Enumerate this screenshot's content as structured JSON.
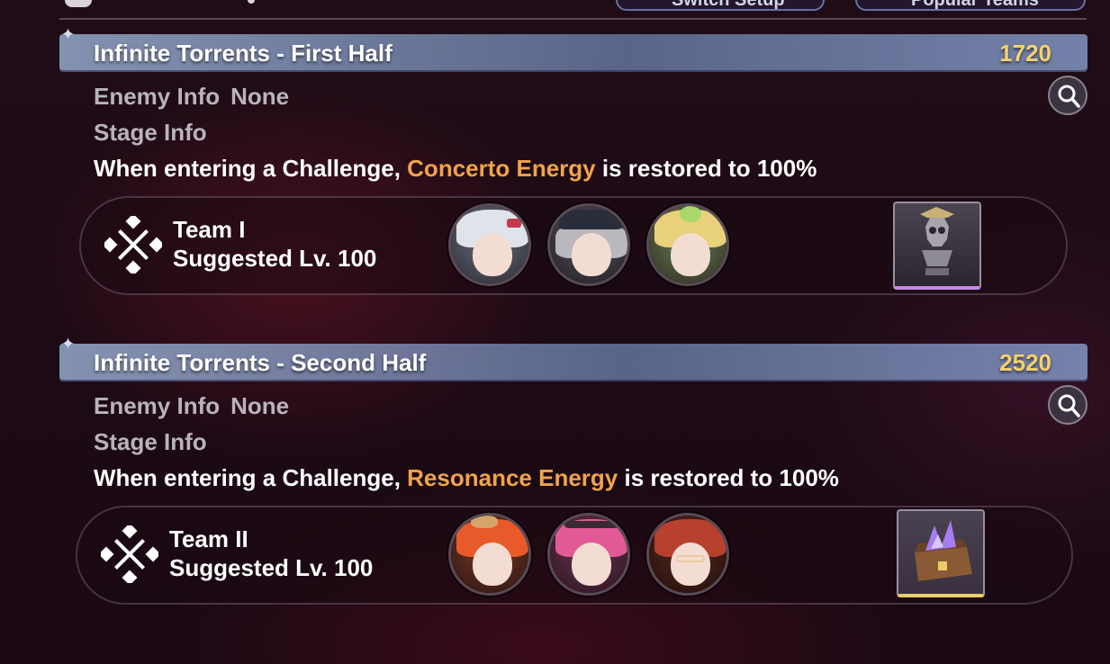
{
  "top": {
    "buttons": [
      {
        "label": "Switch Setup"
      },
      {
        "label": "Popular Teams"
      }
    ]
  },
  "stages": [
    {
      "title": "Infinite Torrents - First Half",
      "score": "1720",
      "enemy_label": "Enemy Info",
      "enemy_value": "None",
      "stage_label": "Stage Info",
      "desc_pre": "When entering a Challenge, ",
      "desc_hl": "Concerto Energy",
      "desc_post": " is restored to 100%",
      "team": {
        "name": "Team I",
        "level": "Suggested Lv. 100",
        "members": [
          {
            "icon": "silver-hair-character-portrait",
            "hair": "#dfe3ea",
            "accent": "#c33a4a"
          },
          {
            "icon": "gray-hair-captain-character-portrait",
            "hair": "#b9b8be",
            "accent": "#2a2d3a"
          },
          {
            "icon": "blonde-hair-character-portrait",
            "hair": "#e8d17a",
            "accent": "#a9d86a"
          }
        ],
        "reward": {
          "icon": "skull-bust-echo-icon",
          "rarity_color": "#c58be0"
        }
      }
    },
    {
      "title": "Infinite Torrents - Second Half",
      "score": "2520",
      "enemy_label": "Enemy Info",
      "enemy_value": "None",
      "stage_label": "Stage Info",
      "desc_pre": "When entering a Challenge, ",
      "desc_hl": "Resonance Energy",
      "desc_post": " is restored to 100%",
      "team": {
        "name": "Team II",
        "level": "Suggested Lv. 100",
        "members": [
          {
            "icon": "orange-hair-character-portrait",
            "hair": "#e85a2a",
            "accent": "#d4a46a"
          },
          {
            "icon": "pink-hair-character-portrait",
            "hair": "#e15a95",
            "accent": "#3a2a35"
          },
          {
            "icon": "red-hair-glasses-character-portrait",
            "hair": "#b8402e",
            "accent": "#e8c9a0"
          }
        ],
        "reward": {
          "icon": "purple-crystal-chest-icon",
          "rarity_color": "#e8cf6a"
        }
      }
    }
  ]
}
